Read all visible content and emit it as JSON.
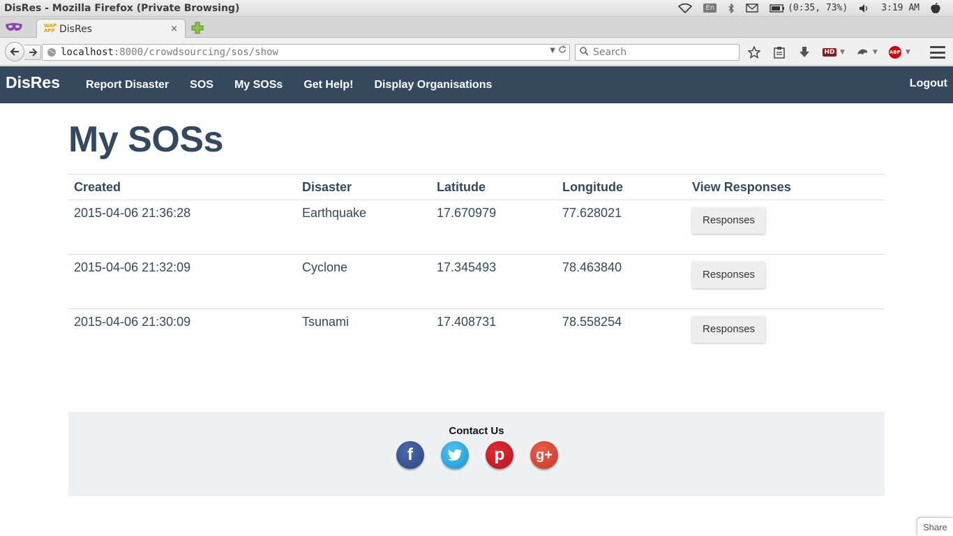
{
  "window": {
    "title": "DisRes - Mozilla Firefox (Private Browsing)",
    "tray": {
      "wifi_icon": "wifi-icon",
      "keyboard_layout": "En",
      "bluetooth_icon": "bluetooth-icon",
      "mail_icon": "mail-icon",
      "battery_text": "(0:35, 73%)",
      "volume_icon": "volume-icon",
      "clock": "3:19 AM",
      "system_icon": "apple-icon"
    }
  },
  "browser": {
    "tab": {
      "favicon_text": "WAP APP",
      "title": "DisRes",
      "close": "×"
    },
    "new_tab": "+",
    "url": {
      "host": "localhost",
      "rest": ":8000/crowdsourcing/sos/show"
    },
    "search_placeholder": "Search",
    "toolbar": {
      "hd_label": "HD",
      "abp_label": "ABP"
    }
  },
  "site": {
    "brand": "DisRes",
    "nav": [
      {
        "label": "Report Disaster"
      },
      {
        "label": "SOS"
      },
      {
        "label": "My SOSs"
      },
      {
        "label": "Get Help!"
      },
      {
        "label": "Display Organisations"
      }
    ],
    "logout": "Logout",
    "page_title": "My SOSs",
    "table": {
      "headers": [
        "Created",
        "Disaster",
        "Latitude",
        "Longitude",
        "View Responses"
      ],
      "rows": [
        {
          "created": "2015-04-06 21:36:28",
          "disaster": "Earthquake",
          "latitude": "17.670979",
          "longitude": "77.628021",
          "action": "Responses"
        },
        {
          "created": "2015-04-06 21:32:09",
          "disaster": "Cyclone",
          "latitude": "17.345493",
          "longitude": "78.463840",
          "action": "Responses"
        },
        {
          "created": "2015-04-06 21:30:09",
          "disaster": "Tsunami",
          "latitude": "17.408731",
          "longitude": "78.558254",
          "action": "Responses"
        }
      ]
    },
    "footer": {
      "title": "Contact Us",
      "social": [
        {
          "name": "facebook-icon",
          "glyph": "f"
        },
        {
          "name": "twitter-icon",
          "glyph": "t"
        },
        {
          "name": "pinterest-icon",
          "glyph": "p"
        },
        {
          "name": "google-plus-icon",
          "glyph": "g+"
        }
      ]
    },
    "share": "Share"
  },
  "colors": {
    "navbar": "#34495e",
    "heading": "#34495e",
    "footer_bg": "#eef0f2"
  }
}
